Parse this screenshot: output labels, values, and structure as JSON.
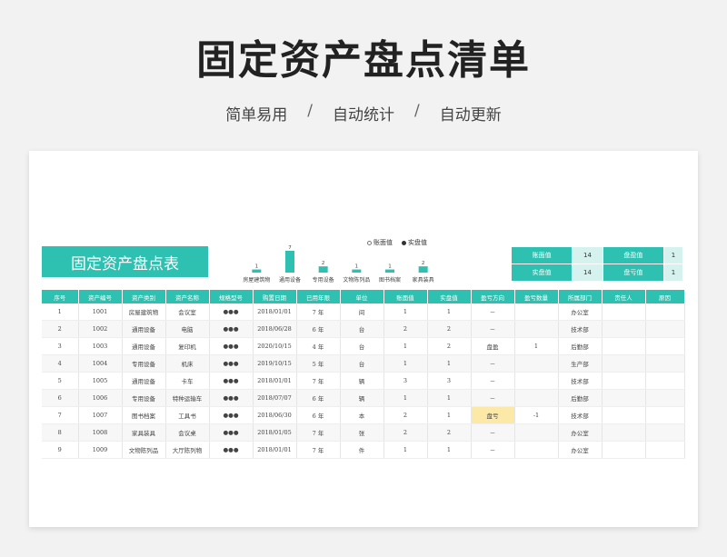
{
  "hero": {
    "title": "固定资产盘点清单",
    "tags": [
      "简单易用",
      "自动统计",
      "自动更新"
    ],
    "separator": "/"
  },
  "sheet": {
    "title": "固定资产盘点表",
    "radio": [
      {
        "label": "账面值",
        "selected": false
      },
      {
        "label": "实盘值",
        "selected": true
      }
    ],
    "summary": [
      {
        "k1": "账面值",
        "v1": "14",
        "k2": "盘盈值",
        "v2": "1"
      },
      {
        "k1": "实盘值",
        "v1": "14",
        "k2": "盘亏值",
        "v2": "1"
      }
    ],
    "headers": [
      "序号",
      "资产编号",
      "资产类别",
      "资产名称",
      "规格型号",
      "购置日期",
      "已用年限",
      "单位",
      "账面值",
      "实盘值",
      "盈亏方向",
      "盈亏数量",
      "所属部门",
      "责任人",
      "原因"
    ],
    "rows": [
      [
        "1",
        "1001",
        "房屋建筑物",
        "会议室",
        "●●●",
        "2018/01/01",
        "7 年",
        "间",
        "1",
        "1",
        "－",
        "",
        "办公室",
        "",
        ""
      ],
      [
        "2",
        "1002",
        "通用设备",
        "电脑",
        "●●●",
        "2018/06/28",
        "6 年",
        "台",
        "2",
        "2",
        "－",
        "",
        "技术部",
        "",
        ""
      ],
      [
        "3",
        "1003",
        "通用设备",
        "复印机",
        "●●●",
        "2020/10/15",
        "4 年",
        "台",
        "1",
        "2",
        "盘盈",
        "1",
        "后勤部",
        "",
        ""
      ],
      [
        "4",
        "1004",
        "专用设备",
        "机床",
        "●●●",
        "2019/10/15",
        "5 年",
        "台",
        "1",
        "1",
        "－",
        "",
        "生产部",
        "",
        ""
      ],
      [
        "5",
        "1005",
        "通用设备",
        "卡车",
        "●●●",
        "2018/01/01",
        "7 年",
        "辆",
        "3",
        "3",
        "－",
        "",
        "技术部",
        "",
        ""
      ],
      [
        "6",
        "1006",
        "专用设备",
        "特种运输车",
        "●●●",
        "2018/07/07",
        "6 年",
        "辆",
        "1",
        "1",
        "－",
        "",
        "后勤部",
        "",
        ""
      ],
      [
        "7",
        "1007",
        "图书档案",
        "工具书",
        "●●●",
        "2018/06/30",
        "6 年",
        "本",
        "2",
        "1",
        "盘亏",
        "-1",
        "技术部",
        "",
        ""
      ],
      [
        "8",
        "1008",
        "家具装具",
        "会议桌",
        "●●●",
        "2018/01/05",
        "7 年",
        "张",
        "2",
        "2",
        "－",
        "",
        "办公室",
        "",
        ""
      ],
      [
        "9",
        "1009",
        "文物陈列品",
        "大厅陈列物",
        "●●●",
        "2018/01/01",
        "7 年",
        "件",
        "1",
        "1",
        "－",
        "",
        "办公室",
        "",
        ""
      ]
    ],
    "colors": {
      "accent": "#2ec0b0",
      "loss_highlight": "#fce9a7",
      "summary_value_bg": "#d5f2ee"
    }
  },
  "chart_data": {
    "type": "bar",
    "categories": [
      "房屋建筑物",
      "通用设备",
      "专用设备",
      "文物陈列品",
      "图书档案",
      "家具装具"
    ],
    "values": [
      1,
      7,
      2,
      1,
      1,
      2
    ],
    "title": "",
    "xlabel": "",
    "ylabel": "",
    "ylim": [
      0,
      7
    ]
  }
}
